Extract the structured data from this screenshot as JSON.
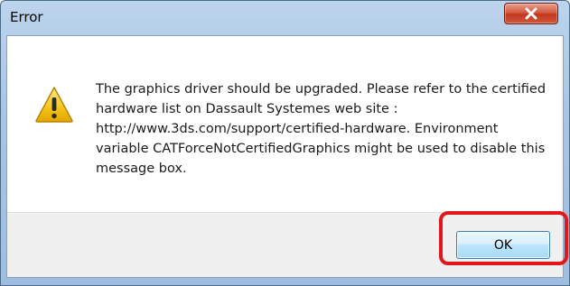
{
  "window": {
    "title": "Error"
  },
  "icons": {
    "close": "close-icon",
    "warning": "warning-icon"
  },
  "message": {
    "text": "The graphics driver should be upgraded. Please refer to the certified hardware list on Dassault Systemes web site : http://www.3ds.com/support/certified-hardware. Environment variable CATForceNotCertifiedGraphics might be used to disable this message box."
  },
  "buttons": {
    "ok_label": "OK"
  },
  "colors": {
    "highlight": "#e3161b",
    "close_button": "#c0371f",
    "warning_yellow": "#f5c518"
  }
}
